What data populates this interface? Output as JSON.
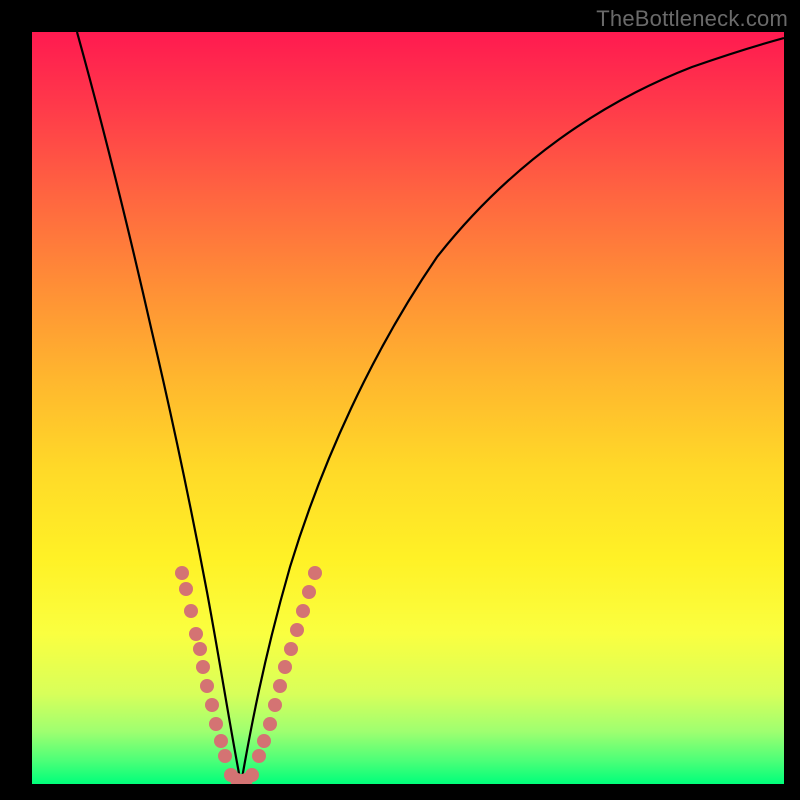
{
  "watermark": "TheBottleneck.com",
  "chart_data": {
    "type": "line",
    "title": "",
    "xlabel": "",
    "ylabel": "",
    "xlim": [
      0,
      100
    ],
    "ylim": [
      0,
      100
    ],
    "background_gradient": {
      "stops": [
        {
          "pos": 0,
          "color": "#ff1a50"
        },
        {
          "pos": 10,
          "color": "#ff3a4a"
        },
        {
          "pos": 22,
          "color": "#ff6640"
        },
        {
          "pos": 34,
          "color": "#ff8f36"
        },
        {
          "pos": 46,
          "color": "#ffb62e"
        },
        {
          "pos": 58,
          "color": "#ffd928"
        },
        {
          "pos": 70,
          "color": "#fff126"
        },
        {
          "pos": 80,
          "color": "#faff40"
        },
        {
          "pos": 88,
          "color": "#d8ff5a"
        },
        {
          "pos": 93,
          "color": "#9fff70"
        },
        {
          "pos": 97,
          "color": "#4aff78"
        },
        {
          "pos": 100,
          "color": "#00ff7a"
        }
      ]
    },
    "series": [
      {
        "name": "left-branch",
        "description": "V-shaped bottleneck curve left arm",
        "x": [
          6,
          8,
          10,
          12,
          14,
          16,
          18,
          20,
          22,
          23.5,
          24.8,
          26,
          27,
          27.8
        ],
        "y": [
          100,
          86,
          73,
          62,
          52,
          43,
          35,
          27,
          19,
          13,
          8,
          4,
          1.5,
          0
        ]
      },
      {
        "name": "right-branch",
        "description": "V-shaped bottleneck curve right arm",
        "x": [
          27.8,
          29,
          31,
          34,
          38,
          43,
          49,
          56,
          64,
          73,
          83,
          93,
          100
        ],
        "y": [
          0,
          1.3,
          5,
          12,
          22,
          33,
          44,
          54,
          63,
          71,
          78,
          83.5,
          87
        ]
      }
    ],
    "marker_series": [
      {
        "name": "highlight-dots-left",
        "color": "#d47373",
        "points": [
          {
            "x": 20.0,
            "y": 28
          },
          {
            "x": 20.5,
            "y": 26
          },
          {
            "x": 21.2,
            "y": 23
          },
          {
            "x": 21.8,
            "y": 20
          },
          {
            "x": 22.3,
            "y": 18
          },
          {
            "x": 22.8,
            "y": 15.5
          },
          {
            "x": 23.3,
            "y": 13
          },
          {
            "x": 23.9,
            "y": 10.5
          },
          {
            "x": 24.5,
            "y": 8
          },
          {
            "x": 25.1,
            "y": 5.8
          },
          {
            "x": 25.7,
            "y": 3.8
          }
        ]
      },
      {
        "name": "highlight-dots-bottom",
        "color": "#d47373",
        "points": [
          {
            "x": 26.4,
            "y": 1.2
          },
          {
            "x": 27.2,
            "y": 0.6
          },
          {
            "x": 27.8,
            "y": 0.5
          },
          {
            "x": 28.5,
            "y": 0.6
          },
          {
            "x": 29.3,
            "y": 1.2
          }
        ]
      },
      {
        "name": "highlight-dots-right",
        "color": "#d47373",
        "points": [
          {
            "x": 30.2,
            "y": 3.8
          },
          {
            "x": 30.9,
            "y": 5.8
          },
          {
            "x": 31.6,
            "y": 8
          },
          {
            "x": 32.3,
            "y": 10.5
          },
          {
            "x": 33.0,
            "y": 13
          },
          {
            "x": 33.7,
            "y": 15.5
          },
          {
            "x": 34.5,
            "y": 18
          },
          {
            "x": 35.3,
            "y": 20.5
          },
          {
            "x": 36.0,
            "y": 23
          },
          {
            "x": 36.8,
            "y": 25.5
          },
          {
            "x": 37.6,
            "y": 28
          }
        ]
      }
    ]
  }
}
